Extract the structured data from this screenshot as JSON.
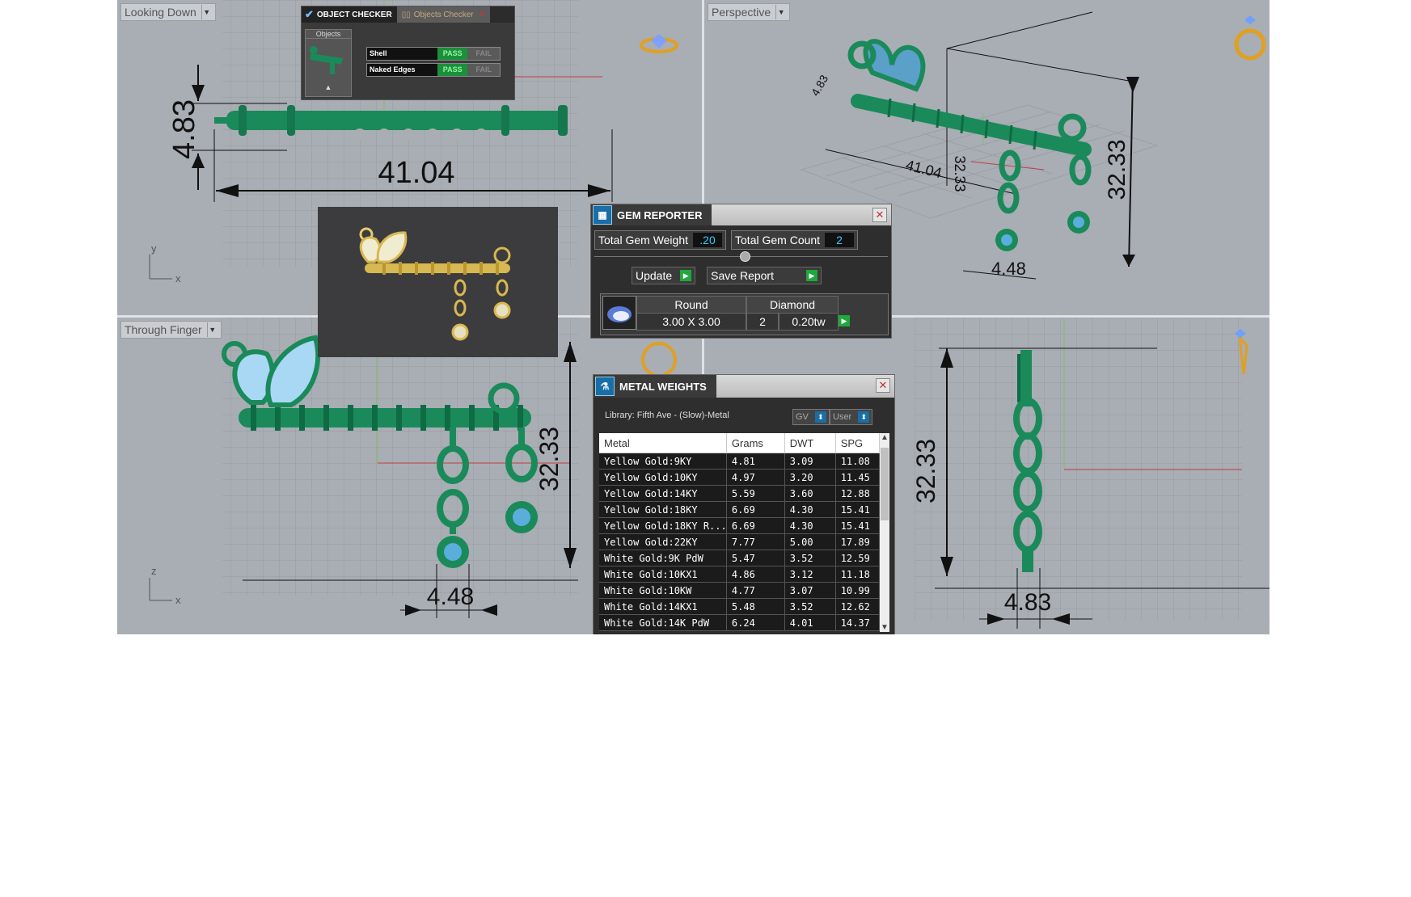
{
  "viewports": {
    "top": {
      "label": "Looking Down",
      "dim_height": "4.83",
      "dim_length": "41.04",
      "axis_y": "y",
      "axis_x": "x"
    },
    "perspective": {
      "label": "Perspective",
      "dim_length": "41.04",
      "dim_depth": "32.33",
      "dim_height": "32.33",
      "dim_width": "4.48",
      "dim_small": "4.83"
    },
    "front": {
      "label": "Through Finger",
      "dim_height": "32.33",
      "dim_width": "4.48",
      "axis_z": "z",
      "axis_x": "x"
    },
    "side": {
      "dim_height": "32.33",
      "dim_width": "4.83"
    }
  },
  "object_checker": {
    "tab_active": "OBJECT CHECKER",
    "tab_inactive": "Objects Checker",
    "objects_header": "Objects",
    "rows": [
      {
        "name": "Shell",
        "pass": "PASS",
        "fail": "FAIL"
      },
      {
        "name": "Naked Edges",
        "pass": "PASS",
        "fail": "FAIL"
      }
    ]
  },
  "gem_reporter": {
    "title": "GEM REPORTER",
    "total_weight_label": "Total Gem Weight",
    "total_weight_value": ".20",
    "total_count_label": "Total Gem Count",
    "total_count_value": "2",
    "update_label": "Update",
    "save_label": "Save Report",
    "gem": {
      "cut": "Round",
      "type": "Diamond",
      "size": "3.00 X 3.00",
      "count": "2",
      "weight": "0.20tw"
    }
  },
  "metal_weights": {
    "title": "METAL WEIGHTS",
    "library": "Library: Fifth Ave - (Slow)-Metal",
    "gv_label": "GV",
    "user_label": "User",
    "columns": [
      "Metal",
      "Grams",
      "DWT",
      "SPG"
    ],
    "rows": [
      [
        "Yellow Gold:9KY",
        "4.81",
        "3.09",
        "11.08"
      ],
      [
        "Yellow Gold:10KY",
        "4.97",
        "3.20",
        "11.45"
      ],
      [
        "Yellow Gold:14KY",
        "5.59",
        "3.60",
        "12.88"
      ],
      [
        "Yellow Gold:18KY",
        "6.69",
        "4.30",
        "15.41"
      ],
      [
        "Yellow Gold:18KY R...",
        "6.69",
        "4.30",
        "15.41"
      ],
      [
        "Yellow Gold:22KY",
        "7.77",
        "5.00",
        "17.89"
      ],
      [
        "White Gold:9K PdW",
        "5.47",
        "3.52",
        "12.59"
      ],
      [
        "White Gold:10KX1",
        "4.86",
        "3.12",
        "11.18"
      ],
      [
        "White Gold:10KW",
        "4.77",
        "3.07",
        "10.99"
      ],
      [
        "White Gold:14KX1",
        "5.48",
        "3.52",
        "12.62"
      ],
      [
        "White Gold:14K PdW",
        "6.24",
        "4.01",
        "14.37"
      ]
    ]
  },
  "colors": {
    "model": "#1a8a5a",
    "gem": "#a9d8f5",
    "viewport_bg": "#a9adb4",
    "pass": "#1c8f3a"
  }
}
